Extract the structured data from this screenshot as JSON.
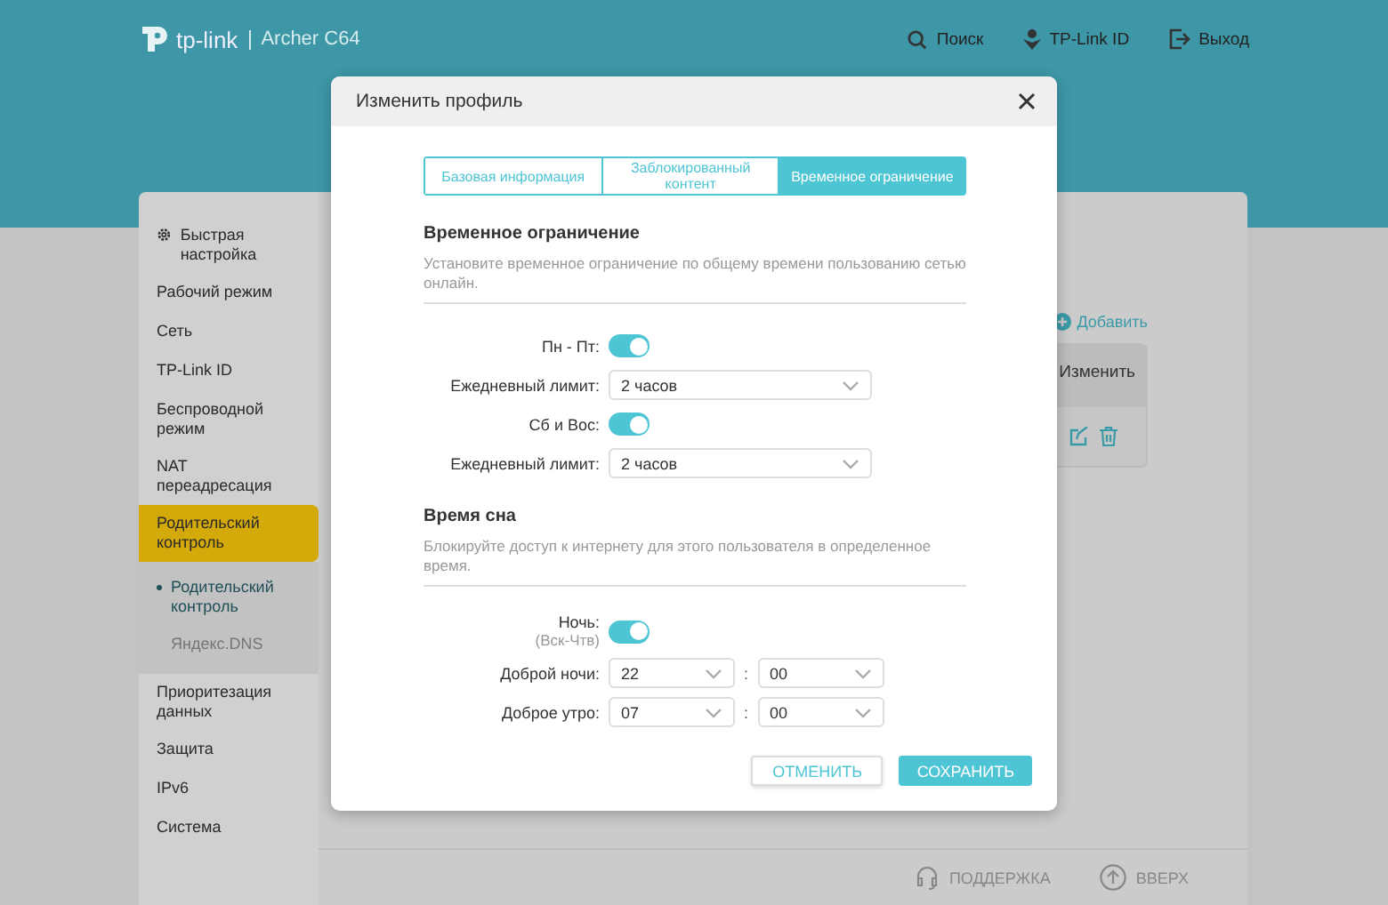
{
  "header": {
    "logo": "tp-link",
    "model": "Archer C64",
    "links": [
      {
        "label": "Поиск",
        "kind": "search"
      },
      {
        "label": "TP-Link ID",
        "kind": "id"
      },
      {
        "label": "Выход",
        "kind": "logout"
      }
    ]
  },
  "sidebar": {
    "items": [
      {
        "label": "Быстрая настройка",
        "kind": "gear",
        "selected": false
      },
      {
        "label": "Рабочий режим",
        "kind": "plain",
        "selected": false
      },
      {
        "label": "Сеть",
        "kind": "plain",
        "selected": false
      },
      {
        "label": "TP-Link ID",
        "kind": "plain",
        "selected": false
      },
      {
        "label": "Беспроводной режим",
        "kind": "plain",
        "selected": false
      },
      {
        "label": "NAT переадресация",
        "kind": "plain",
        "selected": false
      },
      {
        "label": "Родительский контроль",
        "kind": "plain",
        "selected": true,
        "expanded": true,
        "children": [
          {
            "label": "Родительский контроль",
            "selected": true
          },
          {
            "label": "Яндекс.DNS",
            "selected": false
          }
        ]
      },
      {
        "label": "Приоритезация данных",
        "kind": "plain",
        "selected": false
      },
      {
        "label": "Защита",
        "kind": "plain",
        "selected": false
      },
      {
        "label": "IPv6",
        "kind": "plain",
        "selected": false
      },
      {
        "label": "Система",
        "kind": "plain",
        "selected": false
      }
    ]
  },
  "content": {
    "add_link": "Добавить",
    "table": {
      "columns": [
        "Изменить"
      ]
    }
  },
  "footer": {
    "links": [
      {
        "label": "ПОДДЕРЖКА",
        "kind": "support"
      },
      {
        "label": "ВВЕРХ",
        "kind": "up"
      }
    ]
  },
  "modal": {
    "title": "Изменить профиль",
    "tabs": [
      {
        "label": "Базовая информация",
        "selected": false
      },
      {
        "label": "Заблокированный контент",
        "selected": false
      },
      {
        "label": "Временное ограничение",
        "selected": true
      }
    ],
    "sections": [
      {
        "title": "Временное ограничение",
        "description": "Установите временное ограничение по общему времени пользованию сетью онлайн.",
        "rows": [
          {
            "kind": "toggle",
            "label": "Пн - Пт:",
            "on": true
          },
          {
            "kind": "select",
            "label": "Ежедневный лимит:",
            "value": "2 часов"
          },
          {
            "kind": "toggle",
            "label": "Сб и Вос:",
            "on": true
          },
          {
            "kind": "select",
            "label": "Ежедневный лимит:",
            "value": "2 часов"
          }
        ]
      },
      {
        "title": "Время сна",
        "description": "Блокируйте доступ к интернету для этого пользователя в определенное время.",
        "rows": [
          {
            "kind": "toggle",
            "label": "Ночь:",
            "sublabel": "(Вск-Чтв)",
            "on": true
          },
          {
            "kind": "time",
            "label": "Доброй ночи:",
            "hour": "22",
            "separator": ":",
            "minute": "00"
          },
          {
            "kind": "time",
            "label": "Доброе утро:",
            "hour": "07",
            "separator": ":",
            "minute": "00"
          }
        ]
      }
    ],
    "buttons": [
      {
        "label": "ОТМЕНИТЬ",
        "kind": "secondary"
      },
      {
        "label": "СОХРАНИТЬ",
        "kind": "primary"
      }
    ]
  }
}
